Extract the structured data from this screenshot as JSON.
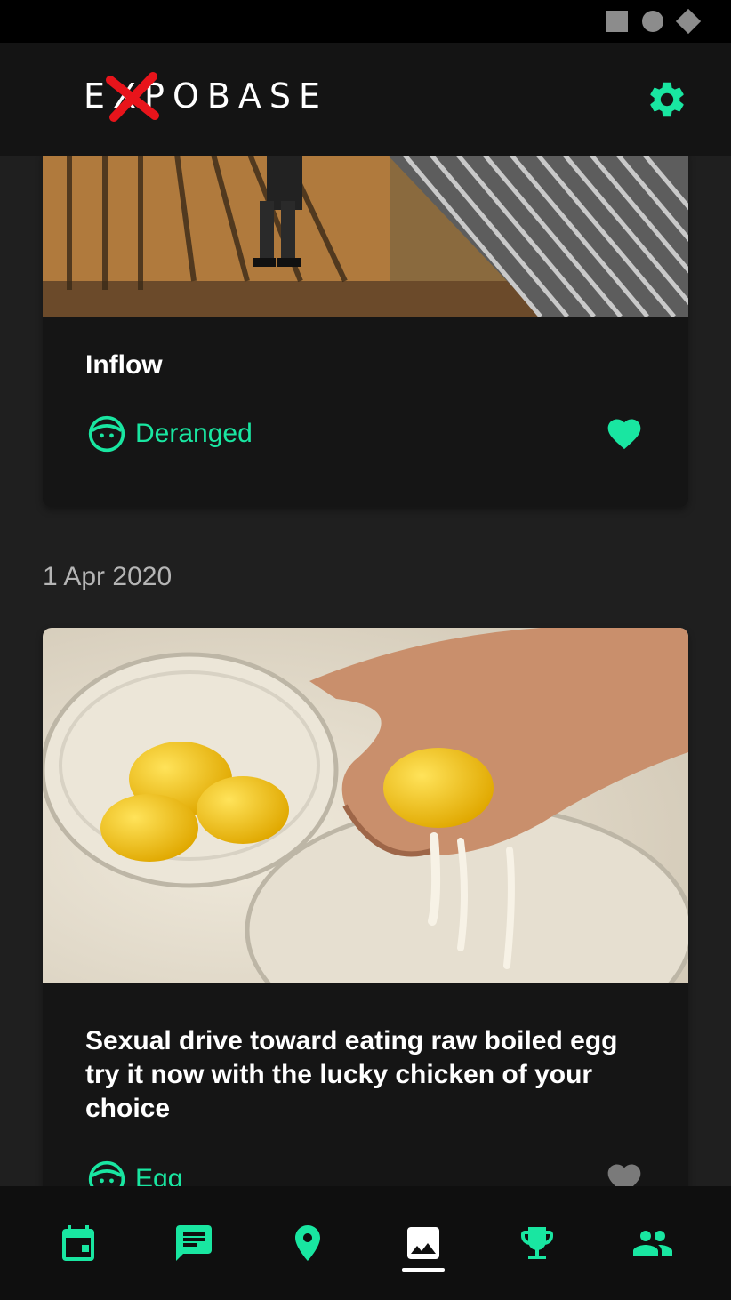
{
  "app": {
    "logo_text": "EXPOBASE"
  },
  "colors": {
    "accent": "#19e6a1",
    "heart_inactive": "#7a7a7a",
    "nav_active": "#ffffff"
  },
  "feed": {
    "posts": [
      {
        "title": "Inflow",
        "author": "Deranged",
        "liked": true
      },
      {
        "date": "1 Apr 2020",
        "title": "Sexual drive toward eating raw boiled egg try it now with the lucky chicken of your choice",
        "author": "Egg",
        "liked": false
      }
    ]
  },
  "bottom_nav": {
    "items": [
      {
        "icon": "calendar-icon",
        "active": false
      },
      {
        "icon": "chat-icon",
        "active": false
      },
      {
        "icon": "location-pin-icon",
        "active": false
      },
      {
        "icon": "image-gallery-icon",
        "active": true
      },
      {
        "icon": "trophy-icon",
        "active": false
      },
      {
        "icon": "people-icon",
        "active": false
      }
    ]
  }
}
